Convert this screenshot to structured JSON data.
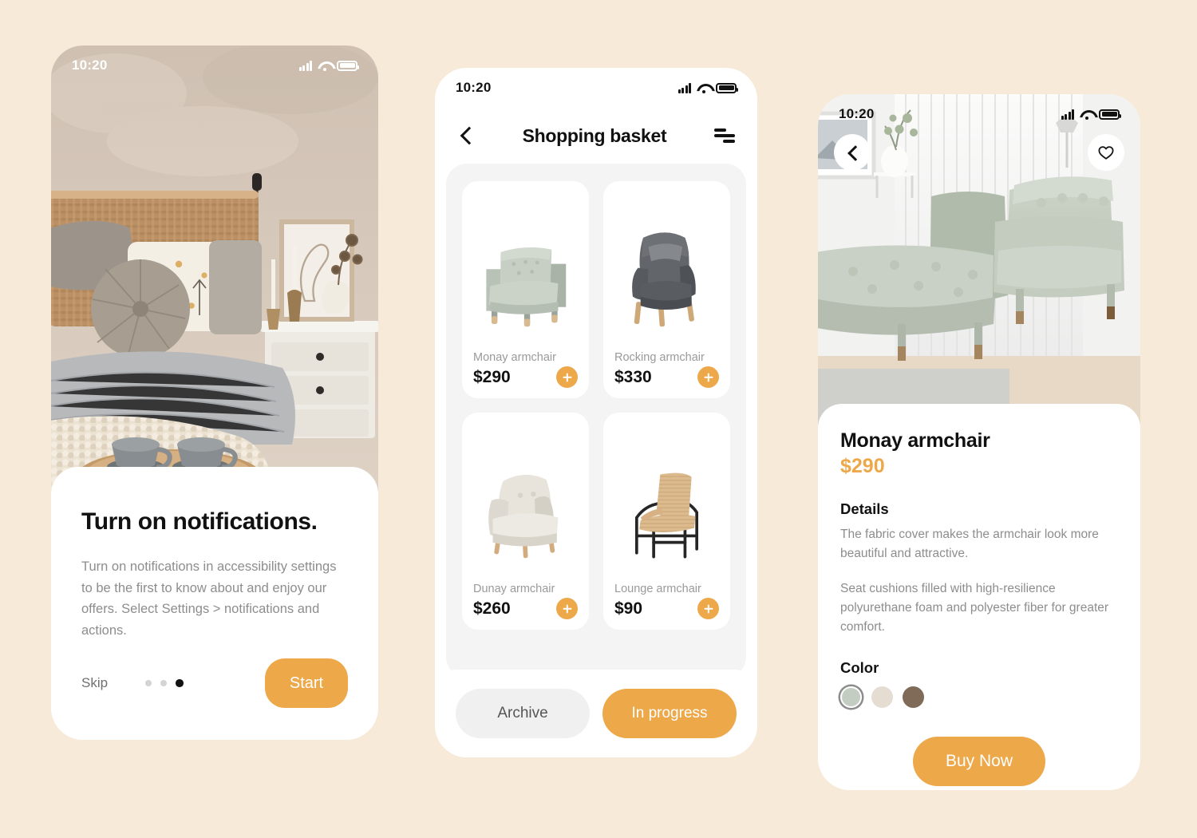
{
  "background_color": "#f7ead9",
  "accent_color": "#eda84a",
  "screens": {
    "onboarding": {
      "status": {
        "time": "10:20",
        "signal_icon": "cellular-bars-icon",
        "wifi_icon": "wifi-icon",
        "battery_icon": "battery-icon"
      },
      "hero_alt": "cozy bedroom with rattan headboard, floral pillows, knit blanket and two mugs on a wooden tray",
      "title": "Turn on notifications.",
      "body": "Turn on notifications in accessibility settings to be the first to know about and enjoy our offers. Select Settings > notifications and actions.",
      "skip_label": "Skip",
      "start_label": "Start",
      "pagination": {
        "total": 3,
        "active_index": 2
      }
    },
    "basket": {
      "status": {
        "time": "10:20"
      },
      "back_icon": "chevron-left-icon",
      "title": "Shopping basket",
      "filter_icon": "filter-lines-icon",
      "products": [
        {
          "name": "Monay armchair",
          "price": "$290",
          "add_label": "+",
          "color": "#c5cec2",
          "style": "boxy-armchair"
        },
        {
          "name": "Rocking armchair",
          "price": "$330",
          "add_label": "+",
          "color": "#5a5a5e",
          "style": "wingback-chair"
        },
        {
          "name": "Dunay armchair",
          "price": "$260",
          "add_label": "+",
          "color": "#e3dfd6",
          "style": "tufted-armchair"
        },
        {
          "name": "Lounge armchair",
          "price": "$90",
          "add_label": "+",
          "color": "#d9bb90",
          "style": "rattan-chair"
        }
      ],
      "tabs": [
        {
          "label": "Archive",
          "active": false
        },
        {
          "label": "In progress",
          "active": true
        }
      ]
    },
    "detail": {
      "status": {
        "time": "10:20"
      },
      "back_icon": "chevron-left-icon",
      "favorite_icon": "heart-icon",
      "hero_alt": "sage green armchair with matching ottoman in a bright white living room",
      "title": "Monay armchair",
      "price": "$290",
      "details_heading": "Details",
      "paragraph_1": "The fabric cover makes the armchair look more beautiful and attractive.",
      "paragraph_2": "Seat cushions filled with high-resilience polyurethane foam and polyester fiber for greater comfort.",
      "color_heading": "Color",
      "colors": [
        {
          "name": "sage-green",
          "hex": "#c4cdc2",
          "selected": true
        },
        {
          "name": "cream",
          "hex": "#e5ddd2",
          "selected": false
        },
        {
          "name": "dark-brown",
          "hex": "#7f6b58",
          "selected": false
        }
      ],
      "buy_label": "Buy Now"
    }
  }
}
